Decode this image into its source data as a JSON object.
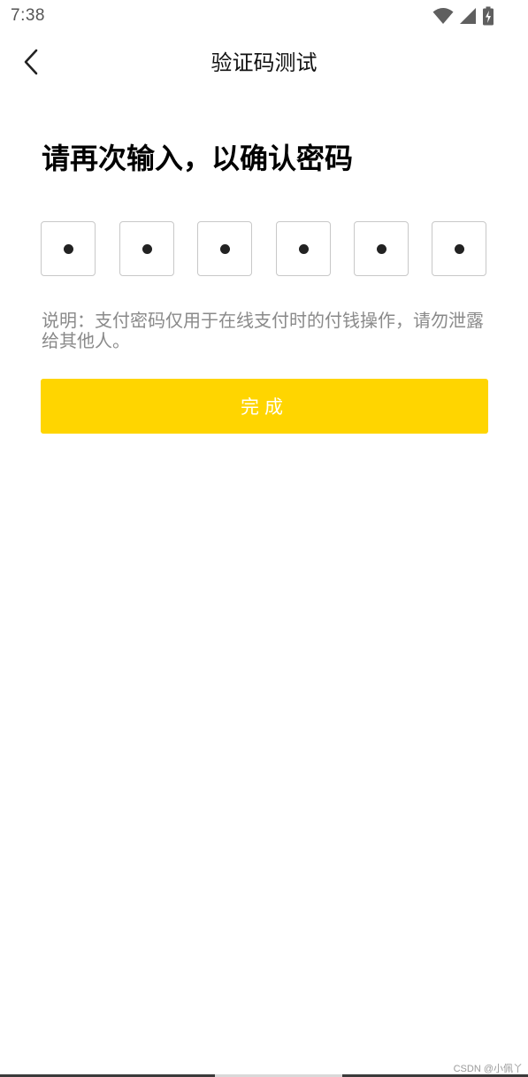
{
  "status_bar": {
    "time": "7:38",
    "icons": [
      "wifi-icon",
      "signal-icon",
      "battery-charging-icon"
    ]
  },
  "header": {
    "title": "验证码测试",
    "back_icon": "chevron-left-icon"
  },
  "main": {
    "heading": "请再次输入，以确认密码",
    "pin": {
      "length": 6,
      "filled": 6,
      "mask_char": "●"
    },
    "note": "说明：支付密码仅用于在线支付时的付钱操作，请勿泄露给其他人。",
    "finish_label": "完成"
  },
  "watermark": "CSDN @小佩丫",
  "colors": {
    "accent": "#ffd500",
    "button_text": "#ffffff",
    "note_text": "#8a8a8a",
    "box_border": "#c8c8c8",
    "dot": "#222222"
  }
}
